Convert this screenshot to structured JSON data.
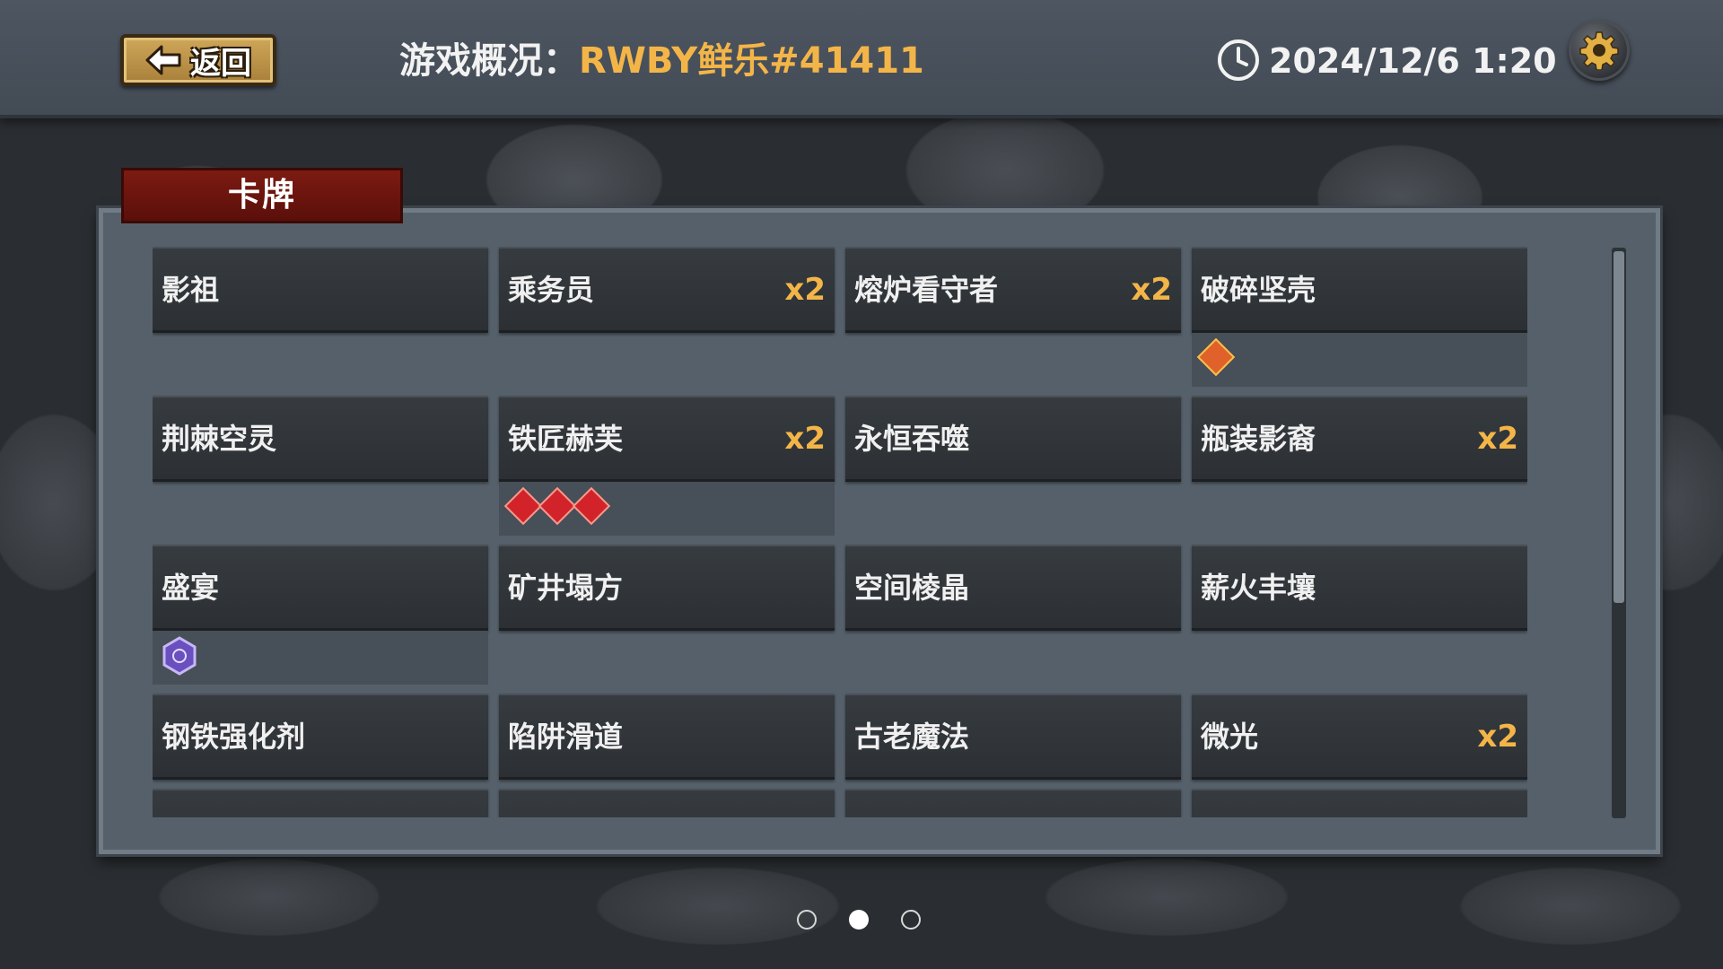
{
  "header": {
    "back_label": "返回",
    "title_prefix": "游戏概况：",
    "game_name": "RWBY鲜乐#41411",
    "datetime": "2024/12/6 1:20"
  },
  "tab": {
    "label": "卡牌"
  },
  "cards": [
    {
      "name": "影祖",
      "count": ""
    },
    {
      "name": "乘务员",
      "count": "x2"
    },
    {
      "name": "熔炉看守者",
      "count": "x2"
    },
    {
      "name": "破碎坚壳",
      "count": ""
    },
    {
      "name": "荆棘空灵",
      "count": ""
    },
    {
      "name": "铁匠赫芙",
      "count": "x2"
    },
    {
      "name": "永恒吞噬",
      "count": ""
    },
    {
      "name": "瓶装影裔",
      "count": "x2"
    },
    {
      "name": "盛宴",
      "count": ""
    },
    {
      "name": "矿井塌方",
      "count": ""
    },
    {
      "name": "空间棱晶",
      "count": ""
    },
    {
      "name": "薪火丰壤",
      "count": ""
    },
    {
      "name": "钢铁强化剂",
      "count": ""
    },
    {
      "name": "陷阱滑道",
      "count": ""
    },
    {
      "name": "古老魔法",
      "count": ""
    },
    {
      "name": "微光",
      "count": "x2"
    }
  ],
  "pagination": {
    "total": 3,
    "current": 2
  },
  "colors": {
    "accent": "#f4b548",
    "tab_red": "#7c1b12",
    "panel": "#56606a"
  }
}
